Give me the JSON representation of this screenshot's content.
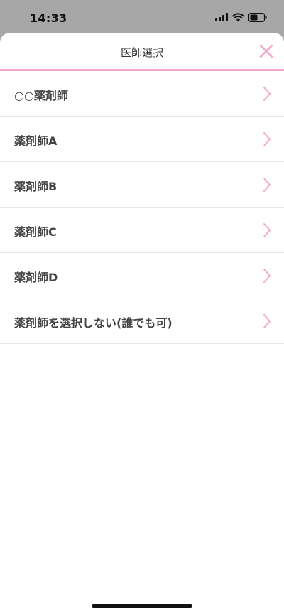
{
  "status_bar": {
    "time": "14:33"
  },
  "header": {
    "title": "医師選択"
  },
  "items": [
    {
      "label": "○○薬剤師"
    },
    {
      "label": "薬剤師A"
    },
    {
      "label": "薬剤師B"
    },
    {
      "label": "薬剤師C"
    },
    {
      "label": "薬剤師D"
    },
    {
      "label": "薬剤師を選択しない(誰でも可)"
    }
  ],
  "icons": {
    "close": "close-icon",
    "chevron": "chevron-right-icon",
    "signal": "signal-icon",
    "wifi": "wifi-icon",
    "battery": "battery-icon"
  },
  "colors": {
    "accent": "#f2a8cc",
    "overlay": "#a7a7a7",
    "text": "#444444"
  }
}
